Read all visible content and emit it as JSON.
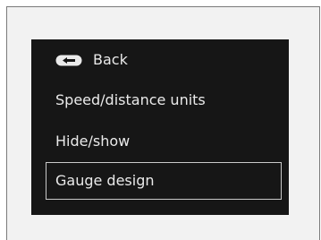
{
  "menu": {
    "back_label": "Back",
    "items": [
      {
        "label": "Speed/distance units"
      },
      {
        "label": "Hide/show"
      },
      {
        "label": "Gauge design"
      }
    ],
    "selected_index": 2
  },
  "icons": {
    "back": "back-arrow-icon"
  },
  "colors": {
    "screen_background": "#161616",
    "text": "#eaeaea",
    "selection_border": "#c9c9c9"
  }
}
